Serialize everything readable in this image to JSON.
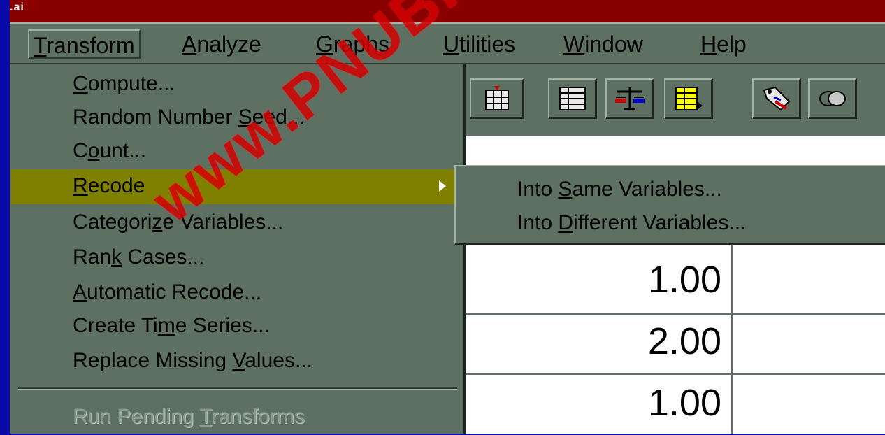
{
  "titlebar": {
    "text": ".ai"
  },
  "menubar": {
    "items": [
      {
        "label_pre": "",
        "mnemonic": "T",
        "label_post": "ransform"
      },
      {
        "label_pre": "",
        "mnemonic": "A",
        "label_post": "nalyze"
      },
      {
        "label_pre": "",
        "mnemonic": "G",
        "label_post": "raphs"
      },
      {
        "label_pre": "",
        "mnemonic": "U",
        "label_post": "tilities"
      },
      {
        "label_pre": "",
        "mnemonic": "W",
        "label_post": "indow"
      },
      {
        "label_pre": "",
        "mnemonic": "H",
        "label_post": "elp"
      }
    ]
  },
  "transform_menu": {
    "items": [
      {
        "pre": "",
        "m": "C",
        "post": "ompute..."
      },
      {
        "pre": "Random Number ",
        "m": "S",
        "post": "eed..."
      },
      {
        "pre": "C",
        "m": "o",
        "post": "unt..."
      },
      {
        "pre": "",
        "m": "R",
        "post": "ecode"
      },
      {
        "pre": "Categori",
        "m": "z",
        "post": "e Variables..."
      },
      {
        "pre": "Ran",
        "m": "k",
        "post": " Cases..."
      },
      {
        "pre": "",
        "m": "A",
        "post": "utomatic Recode..."
      },
      {
        "pre": "Create Ti",
        "m": "m",
        "post": "e Series..."
      },
      {
        "pre": "Replace Missing ",
        "m": "V",
        "post": "alues..."
      },
      {
        "pre": "Run Pending ",
        "m": "T",
        "post": "ransforms"
      }
    ]
  },
  "recode_submenu": {
    "items": [
      {
        "pre": "Into ",
        "m": "S",
        "post": "ame Variables..."
      },
      {
        "pre": "Into ",
        "m": "D",
        "post": "ifferent Variables..."
      }
    ]
  },
  "grid": {
    "values": [
      "1.00",
      "2.00",
      "1.00"
    ]
  },
  "toolbar": {
    "icons": [
      "insert-case-icon",
      "variables-grid-icon",
      "weight-cases-icon",
      "select-cases-icon",
      "value-labels-icon",
      "use-sets-icon"
    ]
  },
  "watermark": {
    "text": "www.PNUBI"
  },
  "colors": {
    "menu_bg": "#5e7062",
    "highlight": "#808000",
    "titlebar": "#8a0000",
    "desktop": "#0a0aa8"
  }
}
